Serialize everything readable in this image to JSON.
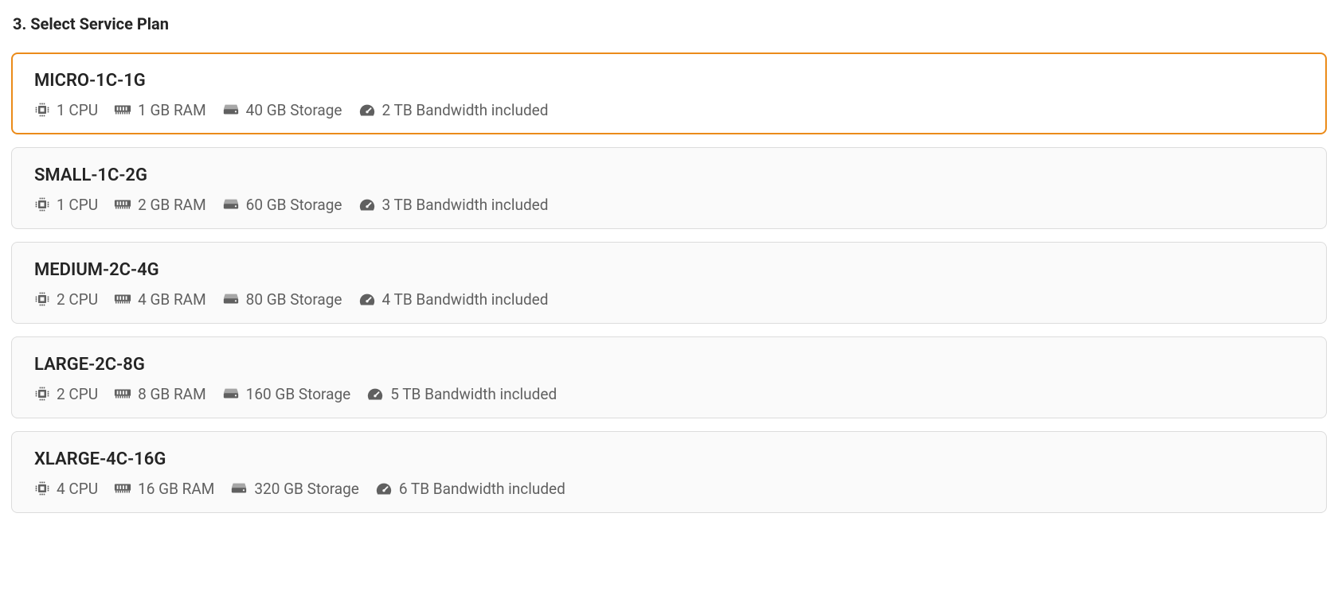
{
  "section": {
    "title": "3. Select Service Plan"
  },
  "selected_index": 0,
  "plans": [
    {
      "name": "MICRO-1C-1G",
      "cpu": "1 CPU",
      "ram": "1 GB RAM",
      "storage": "40 GB Storage",
      "bandwidth": "2 TB Bandwidth included"
    },
    {
      "name": "SMALL-1C-2G",
      "cpu": "1 CPU",
      "ram": "2 GB RAM",
      "storage": "60 GB Storage",
      "bandwidth": "3 TB Bandwidth included"
    },
    {
      "name": "MEDIUM-2C-4G",
      "cpu": "2 CPU",
      "ram": "4 GB RAM",
      "storage": "80 GB Storage",
      "bandwidth": "4 TB Bandwidth included"
    },
    {
      "name": "LARGE-2C-8G",
      "cpu": "2 CPU",
      "ram": "8 GB RAM",
      "storage": "160 GB Storage",
      "bandwidth": "5 TB Bandwidth included"
    },
    {
      "name": "XLARGE-4C-16G",
      "cpu": "4 CPU",
      "ram": "16 GB RAM",
      "storage": "320 GB Storage",
      "bandwidth": "6 TB Bandwidth included"
    }
  ]
}
